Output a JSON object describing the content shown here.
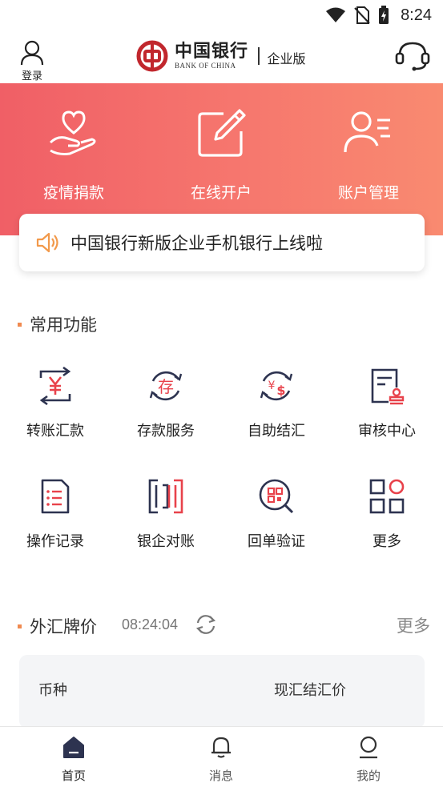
{
  "status_bar": {
    "time": "8:24"
  },
  "header": {
    "login_label": "登录",
    "logo_cn": "中国银行",
    "logo_en": "BANK OF CHINA",
    "edition": "企业版"
  },
  "hero": {
    "items": [
      {
        "label": "疫情捐款",
        "icon": "heart-hand-icon"
      },
      {
        "label": "在线开户",
        "icon": "edit-icon"
      },
      {
        "label": "账户管理",
        "icon": "user-list-icon"
      }
    ]
  },
  "notice": {
    "text": "中国银行新版企业手机银行上线啦",
    "icon": "speaker-icon"
  },
  "common": {
    "title": "常用功能",
    "items": [
      {
        "label": "转账汇款",
        "icon": "transfer-icon"
      },
      {
        "label": "存款服务",
        "icon": "deposit-icon"
      },
      {
        "label": "自助结汇",
        "icon": "exchange-icon"
      },
      {
        "label": "审核中心",
        "icon": "review-icon"
      },
      {
        "label": "操作记录",
        "icon": "record-icon"
      },
      {
        "label": "银企对账",
        "icon": "reconcile-icon"
      },
      {
        "label": "回单验证",
        "icon": "receipt-verify-icon"
      },
      {
        "label": "更多",
        "icon": "more-grid-icon"
      }
    ]
  },
  "forex": {
    "title": "外汇牌价",
    "time": "08:24:04",
    "more": "更多",
    "columns": [
      "币种",
      "现汇结汇价"
    ]
  },
  "nav": {
    "items": [
      {
        "label": "首页",
        "icon": "home-icon",
        "active": true
      },
      {
        "label": "消息",
        "icon": "bell-icon",
        "active": false
      },
      {
        "label": "我的",
        "icon": "profile-icon",
        "active": false
      }
    ]
  },
  "colors": {
    "accent_red": "#f05f66",
    "accent_orange": "#f98a70",
    "icon_navy": "#2d3350",
    "icon_red": "#e8424b",
    "section_bar": "#f08a50"
  }
}
